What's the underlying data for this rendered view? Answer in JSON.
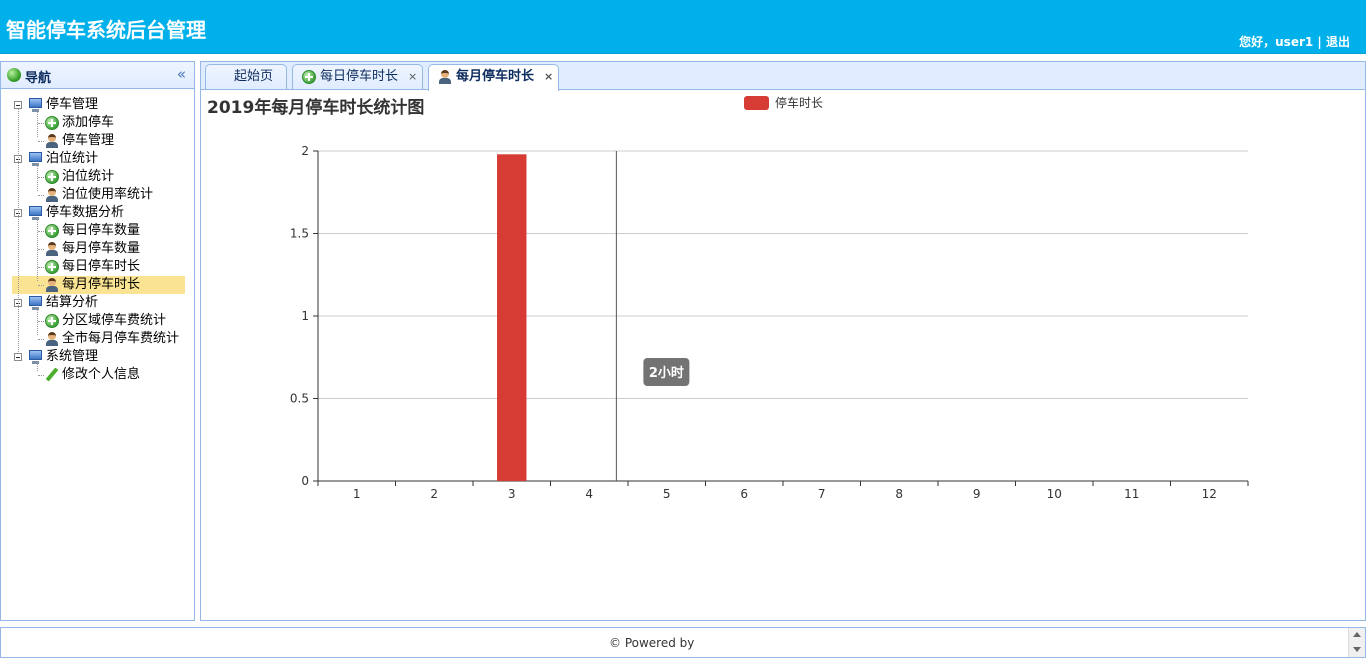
{
  "header": {
    "title": "智能停车系统后台管理",
    "greeting": "您好，user1",
    "separator": " | ",
    "logout": "退出"
  },
  "sidebar": {
    "title": "导航",
    "collapse_icon": "«",
    "groups": [
      {
        "label": "停车管理",
        "items": [
          {
            "label": "添加停车",
            "icon": "plus-icon"
          },
          {
            "label": "停车管理",
            "icon": "user-icon"
          }
        ]
      },
      {
        "label": "泊位统计",
        "items": [
          {
            "label": "泊位统计",
            "icon": "plus-icon"
          },
          {
            "label": "泊位使用率统计",
            "icon": "user-icon"
          }
        ]
      },
      {
        "label": "停车数据分析",
        "items": [
          {
            "label": "每日停车数量",
            "icon": "plus-icon"
          },
          {
            "label": "每月停车数量",
            "icon": "user-icon"
          },
          {
            "label": "每日停车时长",
            "icon": "plus-icon"
          },
          {
            "label": "每月停车时长",
            "icon": "user-icon",
            "selected": true
          }
        ]
      },
      {
        "label": "结算分析",
        "items": [
          {
            "label": "分区域停车费统计",
            "icon": "plus-icon"
          },
          {
            "label": "全市每月停车费统计",
            "icon": "user-icon"
          }
        ]
      },
      {
        "label": "系统管理",
        "items": [
          {
            "label": "修改个人信息",
            "icon": "pencil-icon"
          }
        ]
      }
    ]
  },
  "tabs": [
    {
      "label": "起始页",
      "closable": false
    },
    {
      "label": "每日停车时长",
      "closable": true,
      "icon": "plus-icon"
    },
    {
      "label": "每月停车时长",
      "closable": true,
      "icon": "user-icon",
      "active": true
    }
  ],
  "tab_close_glyph": "×",
  "chart_data": {
    "type": "bar",
    "title": "2019年每月停车时长统计图",
    "categories": [
      "1",
      "2",
      "3",
      "4",
      "5",
      "6",
      "7",
      "8",
      "9",
      "10",
      "11",
      "12"
    ],
    "series": [
      {
        "name": "停车时长",
        "values": [
          0,
          0,
          1.98,
          0,
          0,
          0,
          0,
          0,
          0,
          0,
          0,
          0
        ],
        "color": "#d63b34"
      }
    ],
    "ylim": [
      0,
      2
    ],
    "yticks": [
      0,
      0.5,
      1,
      1.5,
      2
    ],
    "grid": true,
    "legend": "top-center",
    "tooltip": {
      "category": "5",
      "text": "2小时"
    }
  },
  "footer": {
    "text": "© Powered by"
  }
}
